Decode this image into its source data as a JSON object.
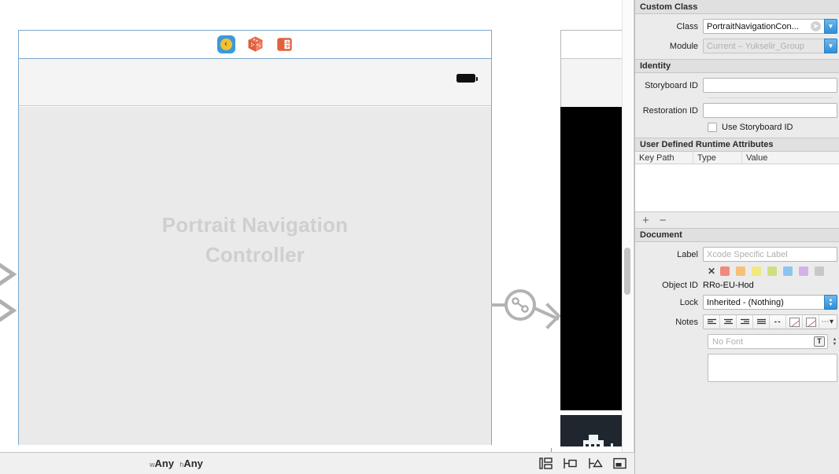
{
  "canvas": {
    "scene": {
      "placeholder_line1": "Portrait Navigation",
      "placeholder_line2": "Controller",
      "dock": {
        "view_controller_icon": "view-controller-icon",
        "view_controller_glyph": "‹",
        "first_responder_icon": "first-responder-cube-icon",
        "exit_icon": "exit-icon"
      },
      "battery_icon": "battery-icon"
    },
    "segue_icon": "relationship-segue-icon",
    "incoming_arrow_icon": "incoming-segue-arrow-icon"
  },
  "bottom_bar": {
    "width_prefix": "w",
    "width_value": "Any",
    "height_prefix": "h",
    "height_value": "Any",
    "buttons": [
      {
        "name": "stack-view-button",
        "title": "Embed In Stack"
      },
      {
        "name": "align-button",
        "title": "Align"
      },
      {
        "name": "pin-button",
        "title": "Pin"
      },
      {
        "name": "resolve-issues-button",
        "title": "Resolve Auto Layout Issues"
      }
    ]
  },
  "inspector": {
    "custom_class": {
      "header": "Custom Class",
      "class_label": "Class",
      "class_value": "PortraitNavigationCon...",
      "module_label": "Module",
      "module_placeholder": "Current – Yukselir_Group"
    },
    "identity": {
      "header": "Identity",
      "storyboard_id_label": "Storyboard ID",
      "storyboard_id_value": "",
      "restoration_id_label": "Restoration ID",
      "restoration_id_value": "",
      "use_storyboard_id_label": "Use Storyboard ID",
      "use_storyboard_id_checked": false
    },
    "runtime_attributes": {
      "header": "User Defined Runtime Attributes",
      "columns": [
        "Key Path",
        "Type",
        "Value"
      ],
      "rows": [],
      "add_label": "+",
      "remove_label": "−"
    },
    "document": {
      "header": "Document",
      "label_label": "Label",
      "label_placeholder": "Xcode Specific Label",
      "label_value": "",
      "clear_color_glyph": "✕",
      "colors": [
        "#f08a7e",
        "#f5c178",
        "#f2e87e",
        "#cde07e",
        "#89c5ef",
        "#d3b2e8",
        "#c8c8c8"
      ],
      "object_id_label": "Object ID",
      "object_id_value": "RRo-EU-Hod",
      "lock_label": "Lock",
      "lock_value": "Inherited - (Nothing)",
      "notes_label": "Notes",
      "notes_buttons": [
        "align-left-icon",
        "align-center-icon",
        "align-right-icon",
        "align-justify-icon",
        "dash-icon",
        "text-color-swatch-icon",
        "highlight-color-swatch-icon",
        "more-options-icon"
      ],
      "font_placeholder": "No Font",
      "font_picker_icon": "font-panel-icon",
      "notes_text": ""
    }
  }
}
